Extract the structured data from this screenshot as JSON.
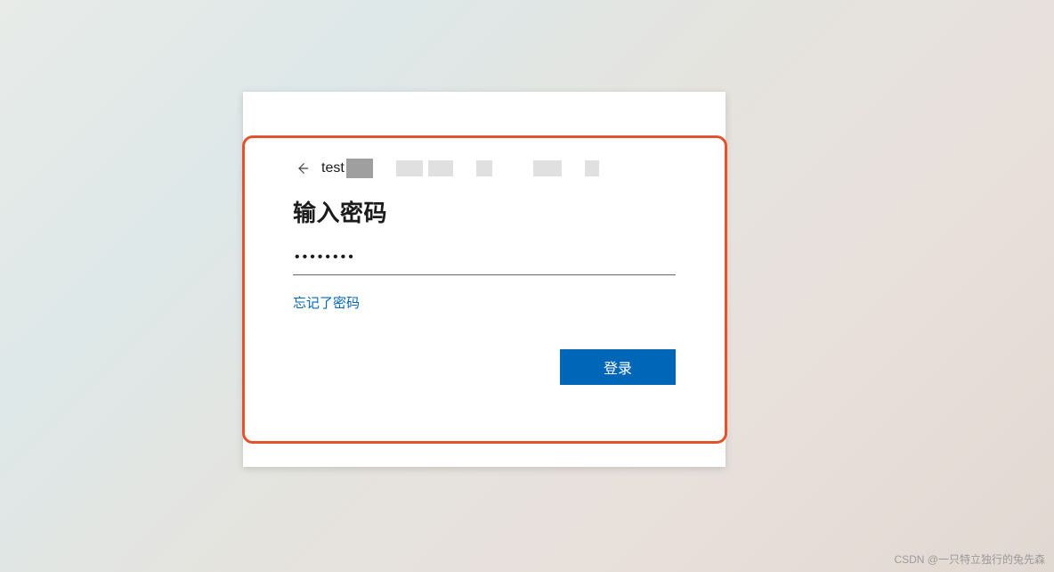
{
  "login": {
    "identity_prefix": "test",
    "title": "输入密码",
    "password_value": "••••••••",
    "password_masked_length": 8,
    "forgot_password_label": "忘记了密码",
    "signin_button_label": "登录"
  },
  "watermark": {
    "text": "CSDN @一只特立独行的兔先森"
  },
  "colors": {
    "primary": "#0067b8",
    "highlight_border": "#e5512c",
    "text": "#1b1b1b"
  }
}
